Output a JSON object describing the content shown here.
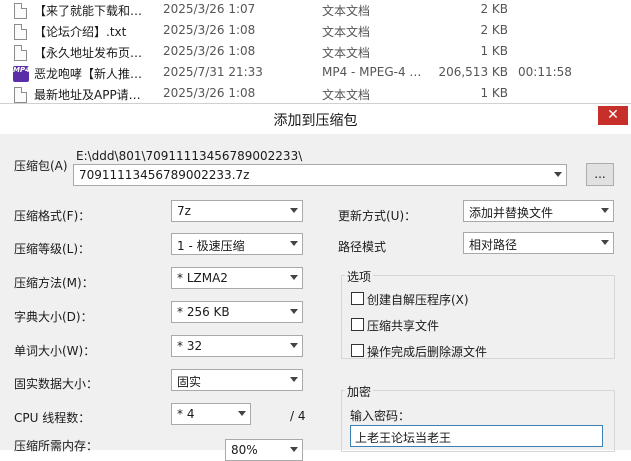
{
  "files": [
    {
      "icon": "text-document-icon",
      "name": "【来了就能下载和…",
      "date": "2025/3/26 1:07",
      "type": "文本文档",
      "size": "2 KB",
      "duration": ""
    },
    {
      "icon": "text-document-icon",
      "name": "【论坛介绍】.txt",
      "date": "2025/3/26 1:08",
      "type": "文本文档",
      "size": "2 KB",
      "duration": ""
    },
    {
      "icon": "text-document-icon",
      "name": "【永久地址发布页…",
      "date": "2025/3/26 1:08",
      "type": "文本文档",
      "size": "1 KB",
      "duration": ""
    },
    {
      "icon": "mp4-video-icon",
      "name": "恶龙咆哮【新人推…",
      "date": "2025/7/31 21:33",
      "type": "MP4 - MPEG-4 …",
      "size": "206,513 KB",
      "duration": "00:11:58"
    },
    {
      "icon": "text-document-icon",
      "name": "最新地址及APP请…",
      "date": "2025/3/26 1:08",
      "type": "文本文档",
      "size": "1 KB",
      "duration": ""
    }
  ],
  "mp4_badge": "MP4",
  "dialog": {
    "title": "添加到压缩包",
    "close": "✕",
    "archive_label": "压缩包(A)",
    "archive_path": "E:\\ddd\\801\\709111134567890022​33\\",
    "archive_name": "709111134567890022​33.7z",
    "browse_label": "...",
    "format_label": "压缩格式(F)：",
    "format_value": "7z",
    "level_label": "压缩等级(L)：",
    "level_value": "1 - 极速压缩",
    "method_label": "压缩方法(M)：",
    "method_value": "* LZMA2",
    "dict_label": "字典大小(D)：",
    "dict_value": "* 256 KB",
    "word_label": "单词大小(W)：",
    "word_value": "* 32",
    "solid_label": "固实数据大小：",
    "solid_value": "固实",
    "cpu_label": "CPU 线程数：",
    "cpu_value": "* 4",
    "cpu_total": "/ 4",
    "memory_label": "压缩所需内存：",
    "memory_value": "80%",
    "update_label": "更新方式(U)：",
    "update_value": "添加并替换文件",
    "path_label": "路径模式",
    "path_value": "相对路径",
    "options_title": "选项",
    "options": [
      "创建自解压程序(X)",
      "压缩共享文件",
      "操作完成后删除源文件"
    ],
    "encrypt_title": "加密",
    "password_label": "输入密码：",
    "password_value": "上老王论坛当老王"
  }
}
